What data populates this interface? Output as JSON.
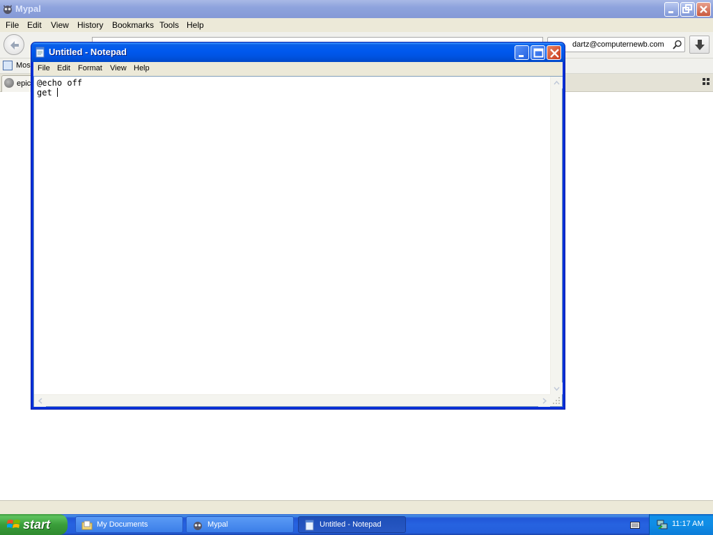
{
  "browser": {
    "title": "Mypal",
    "menu": [
      "File",
      "Edit",
      "View",
      "History",
      "Bookmarks",
      "Tools",
      "Help"
    ],
    "search_value": "dartz@computernewb.com",
    "bookmark_label": "Most",
    "tab_label": "epic"
  },
  "notepad": {
    "title": "Untitled - Notepad",
    "menu": [
      "File",
      "Edit",
      "Format",
      "View",
      "Help"
    ],
    "lines": [
      "@echo off",
      "get "
    ]
  },
  "taskbar": {
    "start_label": "start",
    "items": [
      {
        "label": "My Documents",
        "icon": "folder-icon",
        "active": false
      },
      {
        "label": "Mypal",
        "icon": "mypal-icon",
        "active": false
      },
      {
        "label": "Untitled - Notepad",
        "icon": "notepad-icon",
        "active": true
      }
    ],
    "clock": "11:17 AM"
  },
  "colors": {
    "xp_blue": "#0054e3",
    "start_green": "#3a9e3a",
    "menu_gray": "#ece9d8"
  }
}
